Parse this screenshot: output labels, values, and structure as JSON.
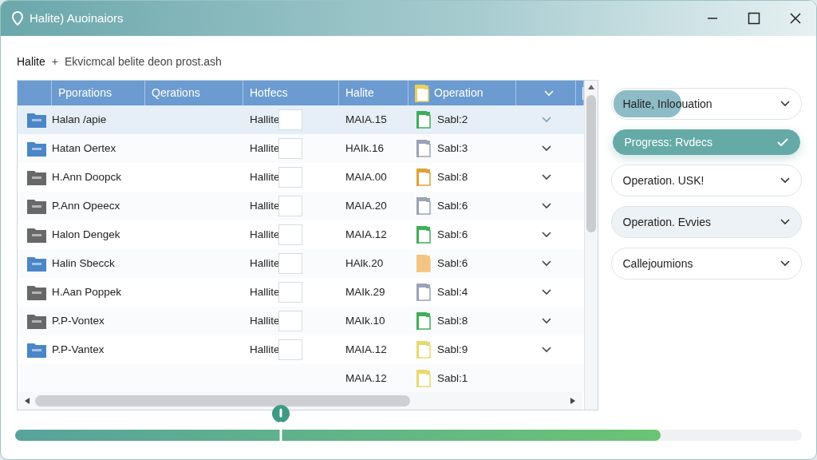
{
  "window": {
    "title": "Halite) Auoinaiors"
  },
  "breadcrumb": {
    "root": "Halite",
    "separator": "+",
    "path": "Ekvicmcal belite deon prost.ash"
  },
  "table": {
    "columns": [
      "Pporations",
      "Qerations",
      "Hotfecs",
      "Halite",
      "Operation"
    ],
    "rows": [
      {
        "name": "Halan /apie",
        "folder": {
          "color": "#4a86c8"
        },
        "tag": "Hallite",
        "code": "MAIA.15",
        "document": {
          "color": "#3fae5a"
        },
        "file": "Sabl:2",
        "selected": true
      },
      {
        "name": "Hatan Oertex",
        "folder": {
          "color": "#4a86c8"
        },
        "tag": "Hallite",
        "code": "HAIk.16",
        "document": {
          "color": "#9aa3b8"
        },
        "file": "Sabl:3",
        "selected": false
      },
      {
        "name": "H.Ann Doopck",
        "folder": {
          "color": "#686868"
        },
        "tag": "Hallite",
        "code": "MAIA.00",
        "document": {
          "color": "#e0a23a"
        },
        "file": "Sabl:8",
        "selected": false
      },
      {
        "name": "P.Ann Opeecx",
        "folder": {
          "color": "#686868"
        },
        "tag": "Hallite",
        "code": "MAIA.20",
        "document": {
          "color": "#9aa3b8"
        },
        "file": "Sabl:6",
        "selected": false
      },
      {
        "name": "Halon Dengek",
        "folder": {
          "color": "#686868"
        },
        "tag": "Hallite",
        "code": "MAIA.12",
        "document": {
          "color": "#3fae5a"
        },
        "file": "Sabl:6",
        "selected": false
      },
      {
        "name": "Halin Sbecck",
        "folder": {
          "color": "#4a86c8"
        },
        "tag": "Hallite",
        "code": "HAlk.20",
        "document": {
          "color": "#f3c585"
        },
        "file": "Sabl:6",
        "selected": false
      },
      {
        "name": "H.Aan Poppek",
        "folder": {
          "color": "#686868"
        },
        "tag": "Hallite",
        "code": "MAIk.29",
        "document": {
          "color": "#9aa3b8"
        },
        "file": "Sabl:4",
        "selected": false
      },
      {
        "name": "P.P-Vontex",
        "folder": {
          "color": "#686868"
        },
        "tag": "Hallite",
        "code": "MAIk.10",
        "document": {
          "color": "#3fae5a"
        },
        "file": "Sabl:8",
        "selected": false
      },
      {
        "name": "P.P-Vantex",
        "folder": {
          "color": "#4a86c8"
        },
        "tag": "Hallite",
        "code": "MAIA.12",
        "document": {
          "color": "#e8d870"
        },
        "file": "Sabl:9",
        "selected": false
      },
      {
        "code": "MAIA.12",
        "document": {
          "color": "#e8d870"
        },
        "file": "Sabl:1",
        "selected": false
      }
    ]
  },
  "filters": [
    {
      "label": "Halite, Inloouation",
      "selected": false,
      "shaded": false,
      "level": 0.36
    },
    {
      "label": "Progress: Rvdecs",
      "selected": true,
      "shaded": false
    },
    {
      "label": "Operation. USK!",
      "selected": false,
      "shaded": false
    },
    {
      "label": "Operation. Evvies",
      "selected": false,
      "shaded": true
    },
    {
      "label": "Callejoumions",
      "selected": false,
      "shaded": false
    }
  ],
  "progress": {
    "level": 0.82,
    "marker": {
      "level": 0.338
    }
  }
}
